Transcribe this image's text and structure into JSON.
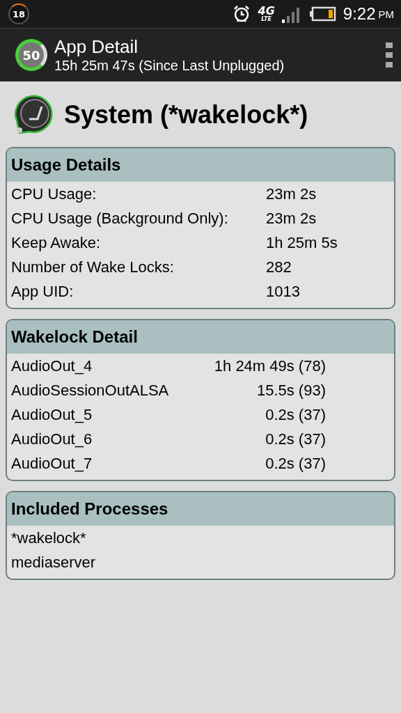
{
  "status_bar": {
    "notification_count": "18",
    "network": "4G",
    "network_sub": "LTE",
    "time": "9:22",
    "ampm": "PM"
  },
  "action_bar": {
    "badge": "50",
    "title": "App Detail",
    "subtitle": "15h 25m 47s (Since Last Unplugged)"
  },
  "app": {
    "name": "System (*wakelock*)"
  },
  "sections": [
    {
      "kind": "kv",
      "title": "Usage Details",
      "rows": [
        {
          "label": "CPU Usage:",
          "value": "23m 2s"
        },
        {
          "label": "CPU Usage (Background Only):",
          "value": "23m 2s"
        },
        {
          "label": "Keep Awake:",
          "value": "1h 25m 5s"
        },
        {
          "label": "Number of Wake Locks:",
          "value": "282"
        },
        {
          "label": "App UID:",
          "value": "1013"
        }
      ]
    },
    {
      "kind": "timing",
      "title": "Wakelock Detail",
      "rows": [
        {
          "label": "AudioOut_4",
          "value": "1h 24m 49s (78)"
        },
        {
          "label": "AudioSessionOutALSA",
          "value": "15.5s (93)"
        },
        {
          "label": "AudioOut_5",
          "value": "0.2s (37)"
        },
        {
          "label": "AudioOut_6",
          "value": "0.2s (37)"
        },
        {
          "label": "AudioOut_7",
          "value": "0.2s (37)"
        }
      ]
    },
    {
      "kind": "list",
      "title": "Included Processes",
      "items": [
        "*wakelock*",
        "mediaserver"
      ]
    }
  ]
}
